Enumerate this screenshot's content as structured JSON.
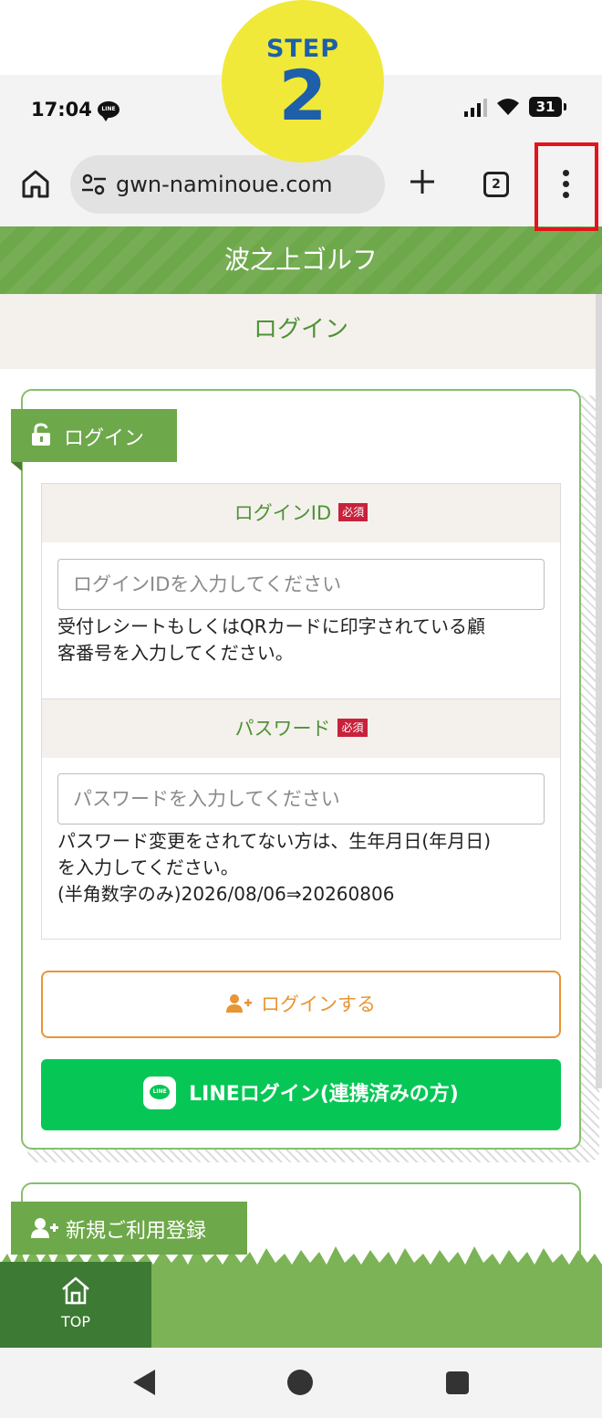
{
  "overlay": {
    "step_word": "STEP",
    "step_number": "2"
  },
  "status_bar": {
    "time": "17:04",
    "line_badge": "LINE",
    "battery": "31"
  },
  "browser": {
    "url": "gwn-naminoue.com",
    "tab_count": "2"
  },
  "site": {
    "title": "波之上ゴルフ",
    "page_title": "ログイン"
  },
  "login_card": {
    "tab_label": "ログイン",
    "required_badge": "必須",
    "id_field": {
      "label": "ログインID",
      "placeholder": "ログインIDを入力してください",
      "help_line1": "受付レシートもしくはQRカードに印字されている顧",
      "help_line2": "客番号を入力してください。"
    },
    "password_field": {
      "label": "パスワード",
      "placeholder": "パスワードを入力してください",
      "help_line1": "パスワード変更をされてない方は、生年月日(年月日)",
      "help_line2": "を入力してください。",
      "help_line3": "(半角数字のみ)2026/08/06⇒20260806"
    },
    "login_button": "ログインする",
    "line_button": "LINEログイン(連携済みの方)"
  },
  "register_card": {
    "tab_label": "新規ご利用登録"
  },
  "footer": {
    "top_label": "TOP"
  },
  "colors": {
    "brand_green": "#6da84a",
    "line_green": "#06c755",
    "login_orange": "#e89534",
    "required_red": "#c8213c",
    "highlight_red": "#e3141b",
    "step_yellow": "#f0e93a",
    "step_blue": "#1d5fa8"
  }
}
